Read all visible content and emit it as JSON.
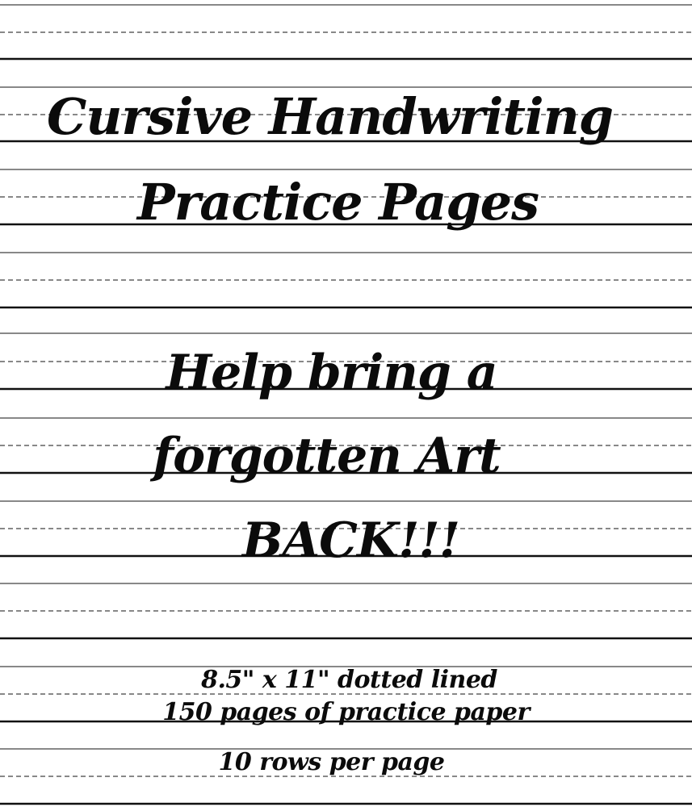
{
  "cover": {
    "background_color": "#ffffff",
    "ink_color": "#0b0b0b",
    "rule_color": "#111111",
    "title_lines": [
      "Cursive Handwriting",
      "Practice Pages"
    ],
    "slogan_lines": [
      "Help bring a",
      "forgotten Art",
      "BACK!!!"
    ],
    "detail_lines": [
      "8.5\" x 11\" dotted lined",
      "150 pages of practice paper",
      "10 rows per page"
    ]
  }
}
